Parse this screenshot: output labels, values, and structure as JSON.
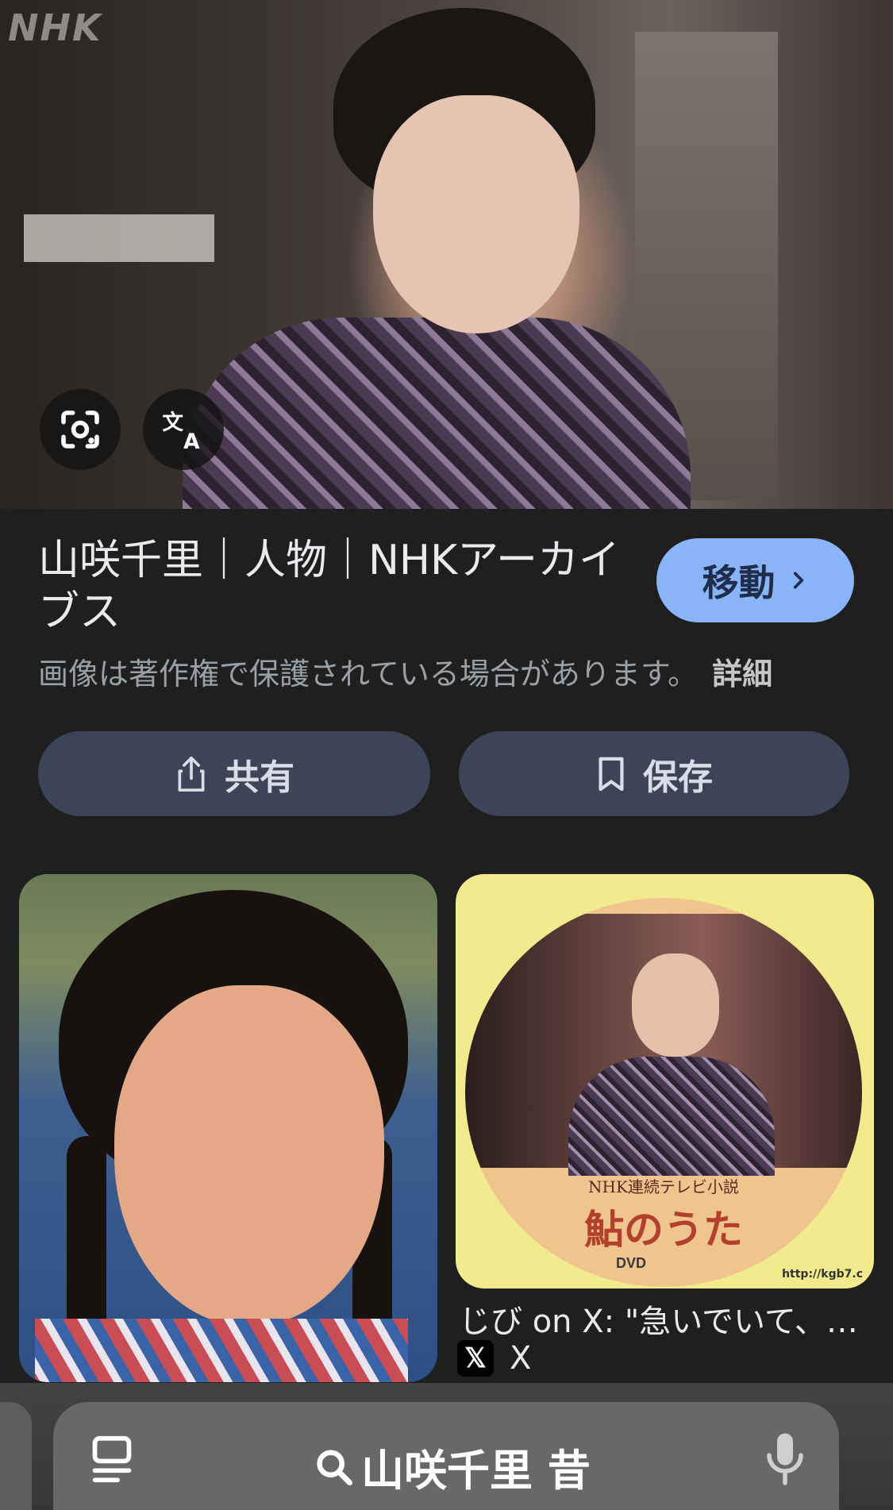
{
  "hero": {
    "watermark": "NHK",
    "lens_icon": "google-lens-icon",
    "translate_icon": "translate-icon"
  },
  "result": {
    "title": "山咲千里｜人物｜NHKアーカイブス",
    "visit_label": "移動",
    "copyright_notice": "画像は著作権で保護されている場合があります。",
    "details_link": "詳細"
  },
  "actions": {
    "share_label": "共有",
    "save_label": "保存"
  },
  "related": [
    {
      "title": "じび on X: \"急いでいて、…",
      "source": "X",
      "image_texts": {
        "series": "NHK連続テレビ小説",
        "show_title": "鮎のうた",
        "url": "http://kgb7.c",
        "dvd": "DVD"
      }
    }
  ],
  "search_bar": {
    "query": "山咲千里 昔"
  },
  "colors": {
    "background": "#1f1f1f",
    "accent_button": "#8ab4f8",
    "secondary_button": "#3c4457"
  }
}
